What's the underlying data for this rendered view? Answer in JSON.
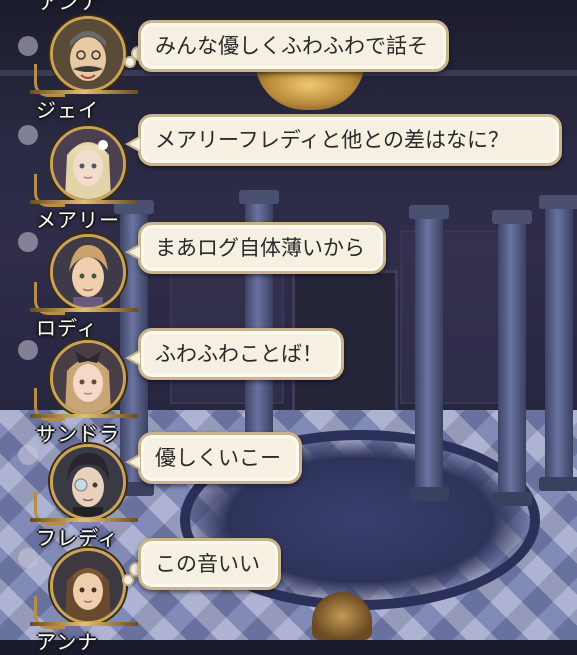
{
  "top_partial_name": "アンナ",
  "messages": [
    {
      "name": "ジェイ",
      "text": "みんな優しくふわふわで話そ",
      "style": "thought"
    },
    {
      "name": "メアリー",
      "text": "メアリーフレディと他との差はなに？",
      "style": "speech"
    },
    {
      "name": "ロディ",
      "text": "まあログ自体薄いから",
      "style": "speech"
    },
    {
      "name": "サンドラ",
      "text": "ふわふわことば！",
      "style": "speech"
    },
    {
      "name": "フレディ",
      "text": "優しくいこー",
      "style": "speech"
    },
    {
      "name": "アンナ",
      "text": "この音いい",
      "style": "thought"
    }
  ],
  "colors": {
    "bubble_fill": "#f6f0e3",
    "bubble_border": "#c9b48c",
    "frame_gold": "#c9a35a",
    "name_text": "#ffffff"
  }
}
